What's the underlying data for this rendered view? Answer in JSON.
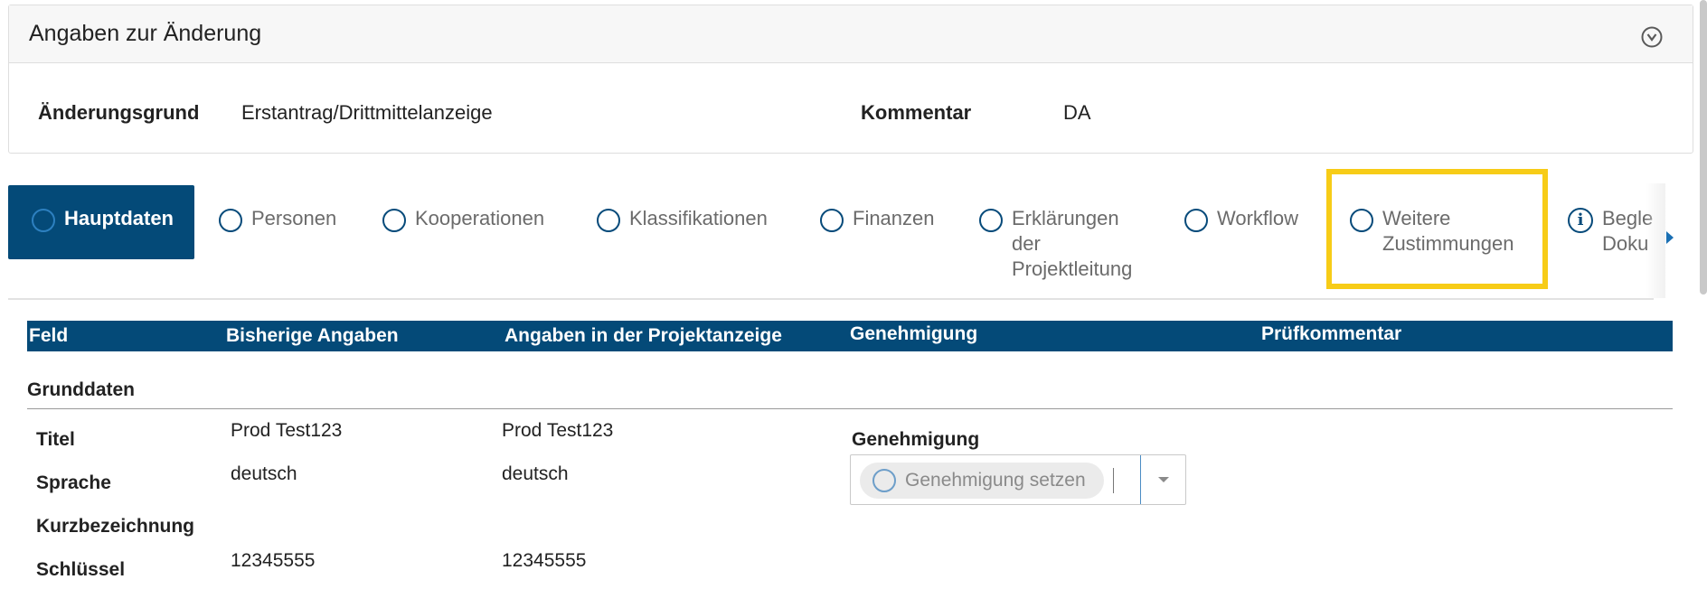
{
  "panel": {
    "title": "Angaben zur Änderung",
    "reason_label": "Änderungsgrund",
    "reason_value": "Erstantrag/Drittmittelanzeige",
    "comment_label": "Kommentar",
    "comment_value": "DA"
  },
  "tabs": [
    {
      "label": "Hauptdaten",
      "state": "active"
    },
    {
      "label": "Personen",
      "state": "inactive"
    },
    {
      "label": "Kooperationen",
      "state": "inactive"
    },
    {
      "label": "Klassifikationen",
      "state": "inactive"
    },
    {
      "label": "Finanzen",
      "state": "inactive"
    },
    {
      "line1": "Erklärungen",
      "line2": "der",
      "line3": "Projektleitung",
      "state": "inactive"
    },
    {
      "label": "Workflow",
      "state": "inactive"
    },
    {
      "line1": "Weitere",
      "line2": "Zustimmungen",
      "state": "highlighted"
    },
    {
      "line1": "Begle",
      "line2": "Doku",
      "state": "info",
      "icon": "info-icon"
    }
  ],
  "table": {
    "headers": [
      "Feld",
      "Bisherige Angaben",
      "Angaben in der Projektanzeige",
      "Genehmigung",
      "Prüfkommentar"
    ],
    "section": "Grunddaten",
    "rows": [
      {
        "field": "Titel",
        "previous": "Prod Test123",
        "current": "Prod Test123"
      },
      {
        "field": "Sprache",
        "previous": "deutsch",
        "current": "deutsch"
      },
      {
        "field": "Kurzbezeichnung",
        "previous": "",
        "current": ""
      },
      {
        "field": "Schlüssel",
        "previous": "12345555",
        "current": "12345555"
      }
    ],
    "approval": {
      "label": "Genehmigung",
      "placeholder": "Genehmigung setzen"
    }
  },
  "colors": {
    "primary": "#044a78",
    "highlight": "#f7cc17",
    "tab_text": "#6b6b6b"
  }
}
